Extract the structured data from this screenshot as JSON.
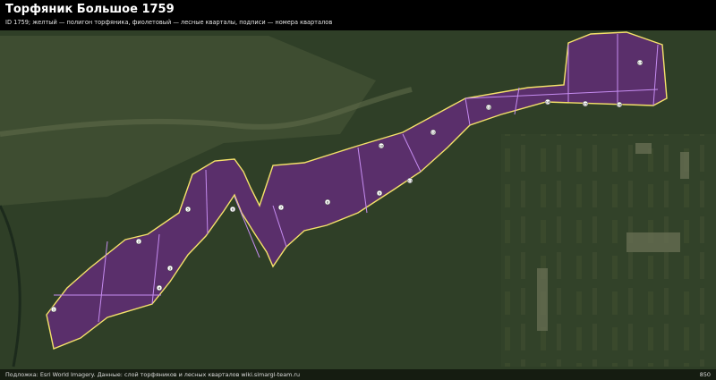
{
  "header": {
    "title": "Торфяник Большое 1759",
    "subtitle": "ID 1759; желтый — полигон торфяника, фиолетовый — лесные кварталы, подписи — номера кварталов"
  },
  "footer": {
    "attribution": "Подложка: Esri World Imagery. Данные: слой торфяников и лесных кварталов wiki.simargl-team.ru",
    "scale_label": "850"
  },
  "colors": {
    "peatland_outline": "#f5e26a",
    "peatland_fill": "#6b2a86",
    "quarter_lines": "#c58cf0"
  },
  "map": {
    "quarter_labels": [
      "1",
      "2",
      "3",
      "4",
      "5",
      "6",
      "7",
      "8",
      "9",
      "10",
      "11",
      "12",
      "13",
      "14",
      "15",
      "16",
      "17"
    ]
  }
}
